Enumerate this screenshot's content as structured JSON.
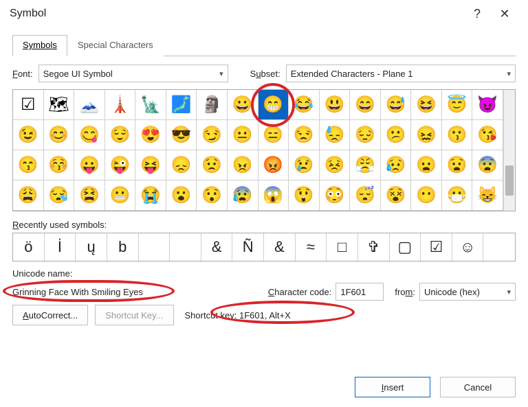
{
  "window": {
    "title": "Symbol"
  },
  "tabs": {
    "symbols": "Symbols",
    "special": "Special Characters"
  },
  "fontRow": {
    "label": "Font:",
    "value": "Segoe UI Symbol",
    "subsetLabel": "Subset:",
    "subsetValue": "Extended Characters - Plane 1"
  },
  "grid": [
    [
      "☑",
      "🗺",
      "🗻",
      "🗼",
      "🗽",
      "🗾",
      "🗿",
      "😀",
      "😁",
      "😂",
      "😃",
      "😄",
      "😅",
      "😆",
      "😇",
      "😈"
    ],
    [
      "😉",
      "😊",
      "😋",
      "😌",
      "😍",
      "😎",
      "😏",
      "😐",
      "😑",
      "😒",
      "😓",
      "😔",
      "😕",
      "😖",
      "😗",
      "😘"
    ],
    [
      "😙",
      "😚",
      "😛",
      "😜",
      "😝",
      "😞",
      "😟",
      "😠",
      "😡",
      "😢",
      "😣",
      "😤",
      "😥",
      "😦",
      "😧",
      "😨"
    ],
    [
      "😩",
      "😪",
      "😫",
      "😬",
      "😭",
      "😮",
      "😯",
      "😰",
      "😱",
      "😲",
      "😳",
      "😴",
      "😵",
      "😶",
      "😷",
      "😸"
    ]
  ],
  "selected": {
    "row": 0,
    "col": 8
  },
  "recentLabel": "Recently used symbols:",
  "recent": [
    "ö",
    "İ",
    "ų",
    "b",
    "",
    "",
    "&",
    "Ñ",
    "&",
    "≈",
    "□",
    "✞",
    "▢",
    "☑",
    "☺",
    ""
  ],
  "unicodeSection": {
    "label": "Unicode name:",
    "name": "Grinning Face With Smiling Eyes"
  },
  "charCode": {
    "label": "Character code:",
    "value": "1F601",
    "fromLabel": "from:",
    "fromValue": "Unicode (hex)"
  },
  "buttons": {
    "autocorrect": "AutoCorrect...",
    "shortcutKeyBtn": "Shortcut Key...",
    "shortcutKeyText": "Shortcut key: 1F601, Alt+X",
    "insert": "Insert",
    "cancel": "Cancel"
  }
}
